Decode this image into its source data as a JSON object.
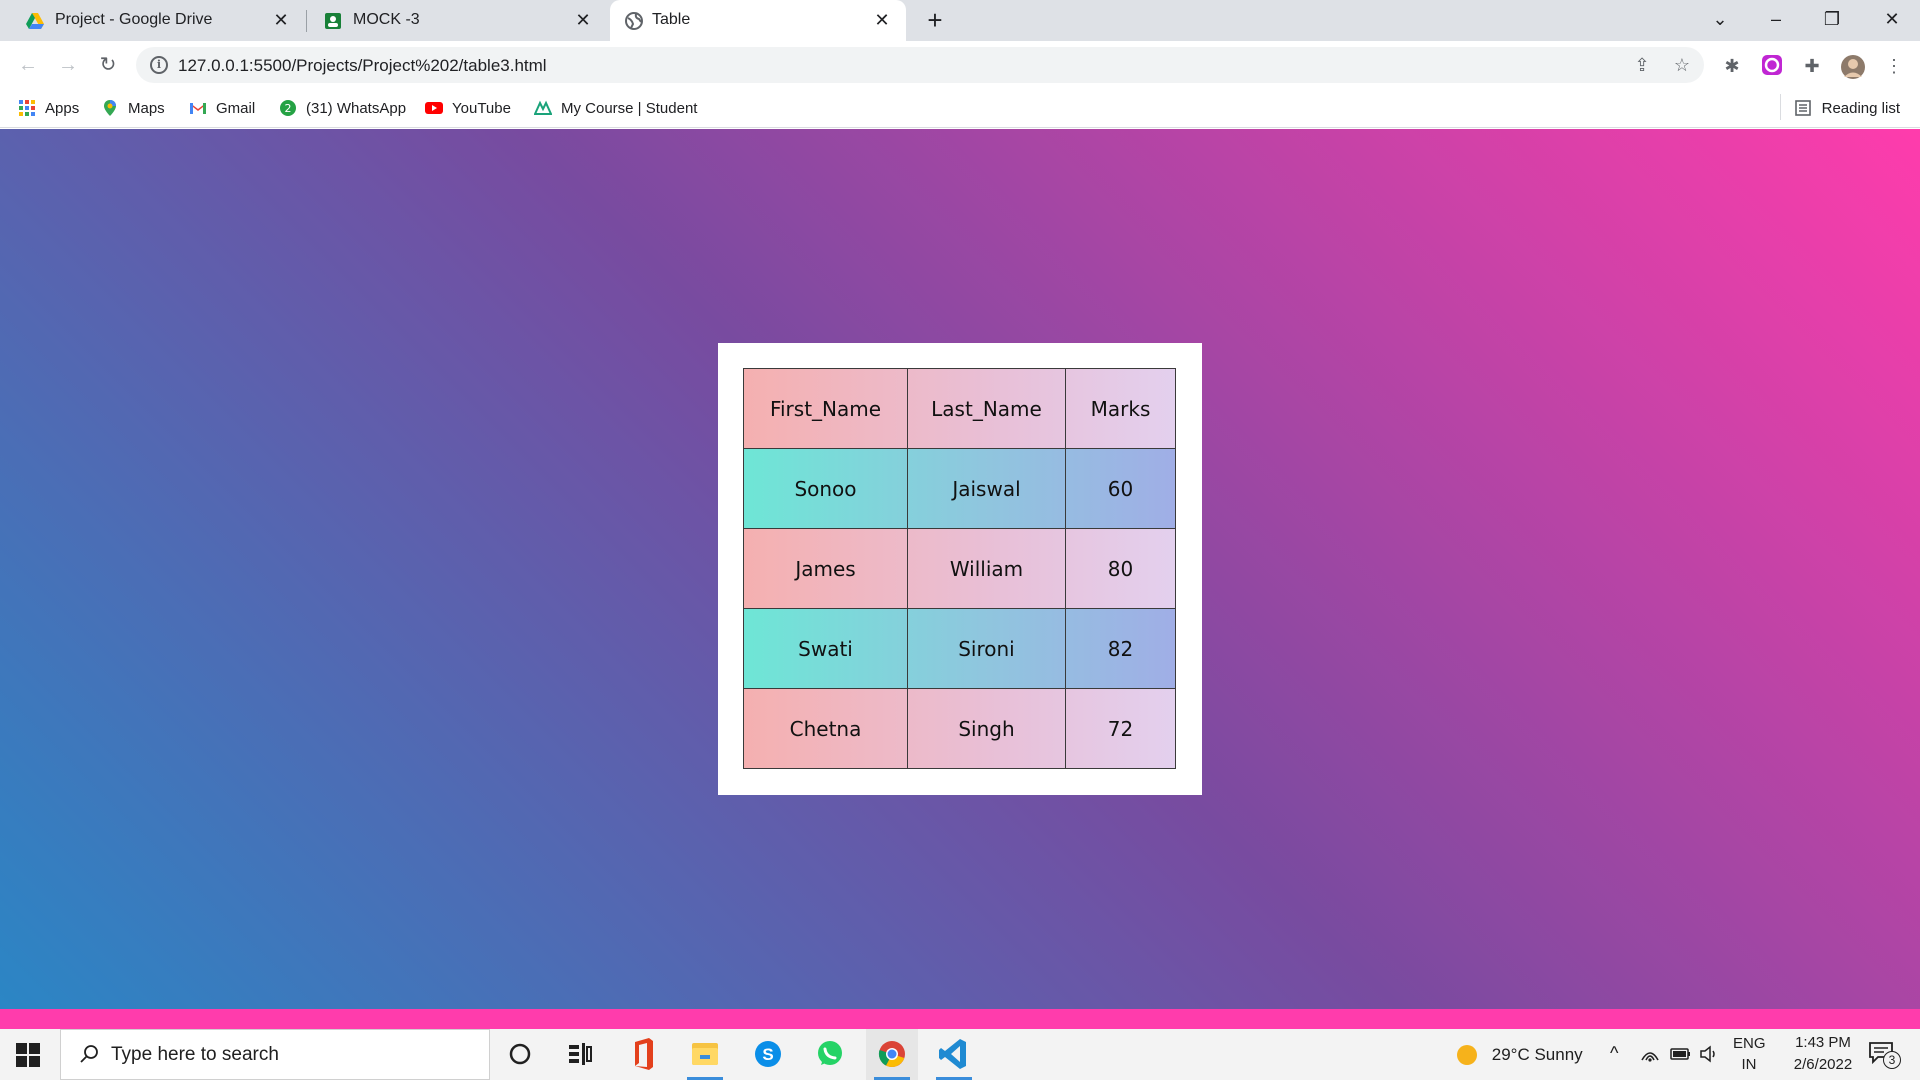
{
  "browser": {
    "tabs": [
      {
        "title": "Project - Google Drive",
        "favicon": "google-drive-icon"
      },
      {
        "title": "MOCK -3",
        "favicon": "google-sheets-icon"
      },
      {
        "title": "Table",
        "favicon": "globe-icon",
        "active": true
      }
    ],
    "url": "127.0.0.1:5500/Projects/Project%202/table3.html",
    "bookmarks": [
      "Apps",
      "Maps",
      "Gmail",
      "(31) WhatsApp",
      "YouTube",
      "My Course | Student"
    ],
    "reading_list": "Reading list"
  },
  "table": {
    "headers": [
      "First_Name",
      "Last_Name",
      "Marks"
    ],
    "rows": [
      [
        "Sonoo",
        "Jaiswal",
        "60"
      ],
      [
        "James",
        "William",
        "80"
      ],
      [
        "Swati",
        "Sironi",
        "82"
      ],
      [
        "Chetna",
        "Singh",
        "72"
      ]
    ]
  },
  "taskbar": {
    "search_placeholder": "Type here to search",
    "weather": "29°C  Sunny",
    "lang_line1": "ENG",
    "lang_line2": "IN",
    "time": "1:43 PM",
    "date": "2/6/2022",
    "notification_count": "3"
  },
  "colors": {
    "page_gradient": [
      "#ff3cac",
      "#784ba0",
      "#2b86c5"
    ],
    "taskbar_accent": "#ff3cac"
  }
}
